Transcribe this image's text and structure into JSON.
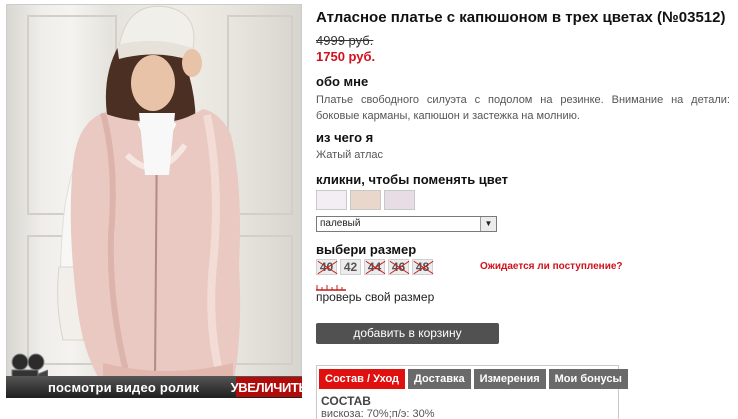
{
  "product": {
    "title": "Атласное платье с капюшоном в трех цветах (№03512)",
    "old_price": "4999 руб.",
    "new_price": "1750 руб."
  },
  "about": {
    "heading": "обо мне",
    "text": "Платье свободного силуэта с подолом на резинке. Внимание на детали: боковые карманы, капюшон и застежка на молнию."
  },
  "material": {
    "heading": "из чего я",
    "text": "Жатый атлас"
  },
  "colors": {
    "heading": "кликни, чтобы поменять цвет",
    "swatches": [
      "#f3eef3",
      "#ead7cc",
      "#e8dde4"
    ],
    "selected": "палевый"
  },
  "sizes": {
    "heading": "выбери размер",
    "items": [
      {
        "label": "40",
        "available": false
      },
      {
        "label": "42",
        "available": true
      },
      {
        "label": "44",
        "available": false
      },
      {
        "label": "46",
        "available": false
      },
      {
        "label": "48",
        "available": false
      }
    ],
    "expected_link": "Ожидается ли поступление?",
    "check_size": "проверь свой размер"
  },
  "cart": {
    "add_label": "добавить в корзину"
  },
  "image": {
    "video_label": "посмотри видео ролик",
    "zoom_label": "УВЕЛИЧИТЬ"
  },
  "tabs": {
    "items": [
      "Состав / Уход",
      "Доставка",
      "Измерения",
      "Мои бонусы"
    ],
    "active": "Состав / Уход",
    "body_title": "СОСТАВ",
    "body_text": "вискоза: 70%;п/э: 30%"
  }
}
